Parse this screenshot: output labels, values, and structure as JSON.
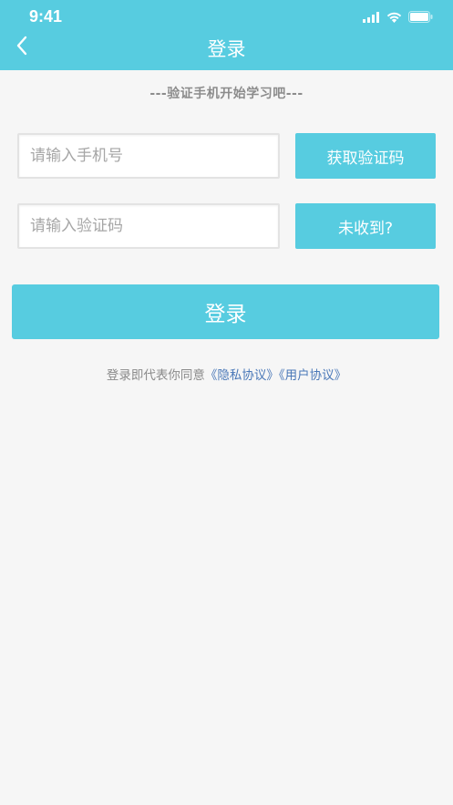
{
  "status_bar": {
    "time": "9:41"
  },
  "nav": {
    "title": "登录",
    "back_icon": "chevron-left-icon"
  },
  "slogan": "---验证手机开始学习吧---",
  "phone": {
    "placeholder": "请输入手机号",
    "value": ""
  },
  "get_code_button": "获取验证码",
  "code": {
    "placeholder": "请输入验证码",
    "value": ""
  },
  "not_received_button": "未收到?",
  "login_button": "登录",
  "agreement": {
    "prefix": "登录即代表你同意",
    "privacy_link": "《隐私协议》",
    "user_link": "《用户协议》"
  },
  "colors": {
    "accent": "#57cce0",
    "background": "#f6f6f6",
    "link": "#4a78b8"
  }
}
